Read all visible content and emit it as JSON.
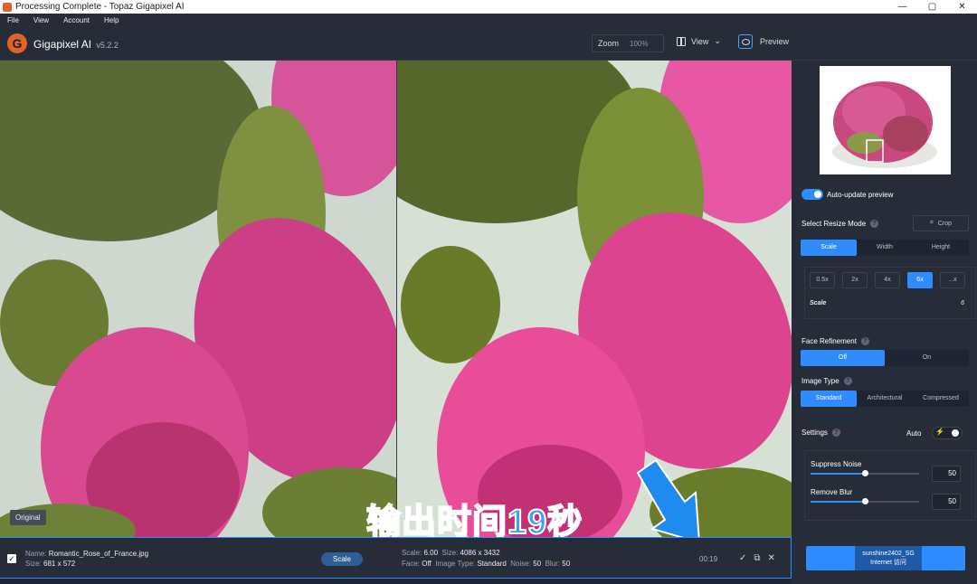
{
  "window": {
    "title": "Processing Complete - Topaz Gigapixel AI",
    "minimize": "—",
    "maximize": "▢",
    "close": "✕"
  },
  "menu": [
    "File",
    "View",
    "Account",
    "Help"
  ],
  "header": {
    "logo_letter": "G",
    "app_name": "Gigapixel AI",
    "version": "v5.2.2",
    "zoom_label": "Zoom",
    "zoom_value": "100%",
    "view_label": "View",
    "preview_label": "Preview"
  },
  "viewer": {
    "original_label": "Original",
    "caption": "输出时间19秒"
  },
  "panel": {
    "auto_update_label": "Auto-update preview",
    "resize_mode_title": "Select Resize Mode",
    "crop_label": "Crop",
    "resize_tabs": [
      "Scale",
      "Width",
      "Height"
    ],
    "scale_chips": [
      "0.5x",
      "2x",
      "4x",
      "6x",
      "...x"
    ],
    "scale_label": "Scale",
    "scale_value": "6",
    "face_title": "Face Refinement",
    "face_tabs": [
      "Off",
      "On"
    ],
    "image_type_title": "Image Type",
    "image_type_tabs": [
      "Standard",
      "Architectural",
      "Compressed"
    ],
    "settings_title": "Settings",
    "auto_label": "Auto",
    "suppress_noise_label": "Suppress Noise",
    "suppress_noise_value": "50",
    "remove_blur_label": "Remove Blur",
    "remove_blur_value": "50",
    "watermark": "sunshine2402_SG Internet 访问"
  },
  "bottom": {
    "name_label": "Name:",
    "name_value": "Romantic_Rose_of_France.jpg",
    "size_label": "Size:",
    "size_value": "681 x 572",
    "scale_pill": "Scale",
    "scale_label": "Scale:",
    "scale_value": "6.00",
    "out_size_label": "Size:",
    "out_size_value": "4086 x 3432",
    "face_label": "Face:",
    "face_value": "Off",
    "image_type_label": "Image Type:",
    "image_type_value": "Standard",
    "noise_label": "Noise:",
    "noise_value": "50",
    "blur_label": "Blur:",
    "blur_value": "50",
    "elapsed": "00:19"
  },
  "colors": {
    "accent": "#2f8cff",
    "bg": "#1e2530",
    "panel": "#262d38",
    "brand": "#e1632a",
    "petal": "#d94a8c"
  }
}
